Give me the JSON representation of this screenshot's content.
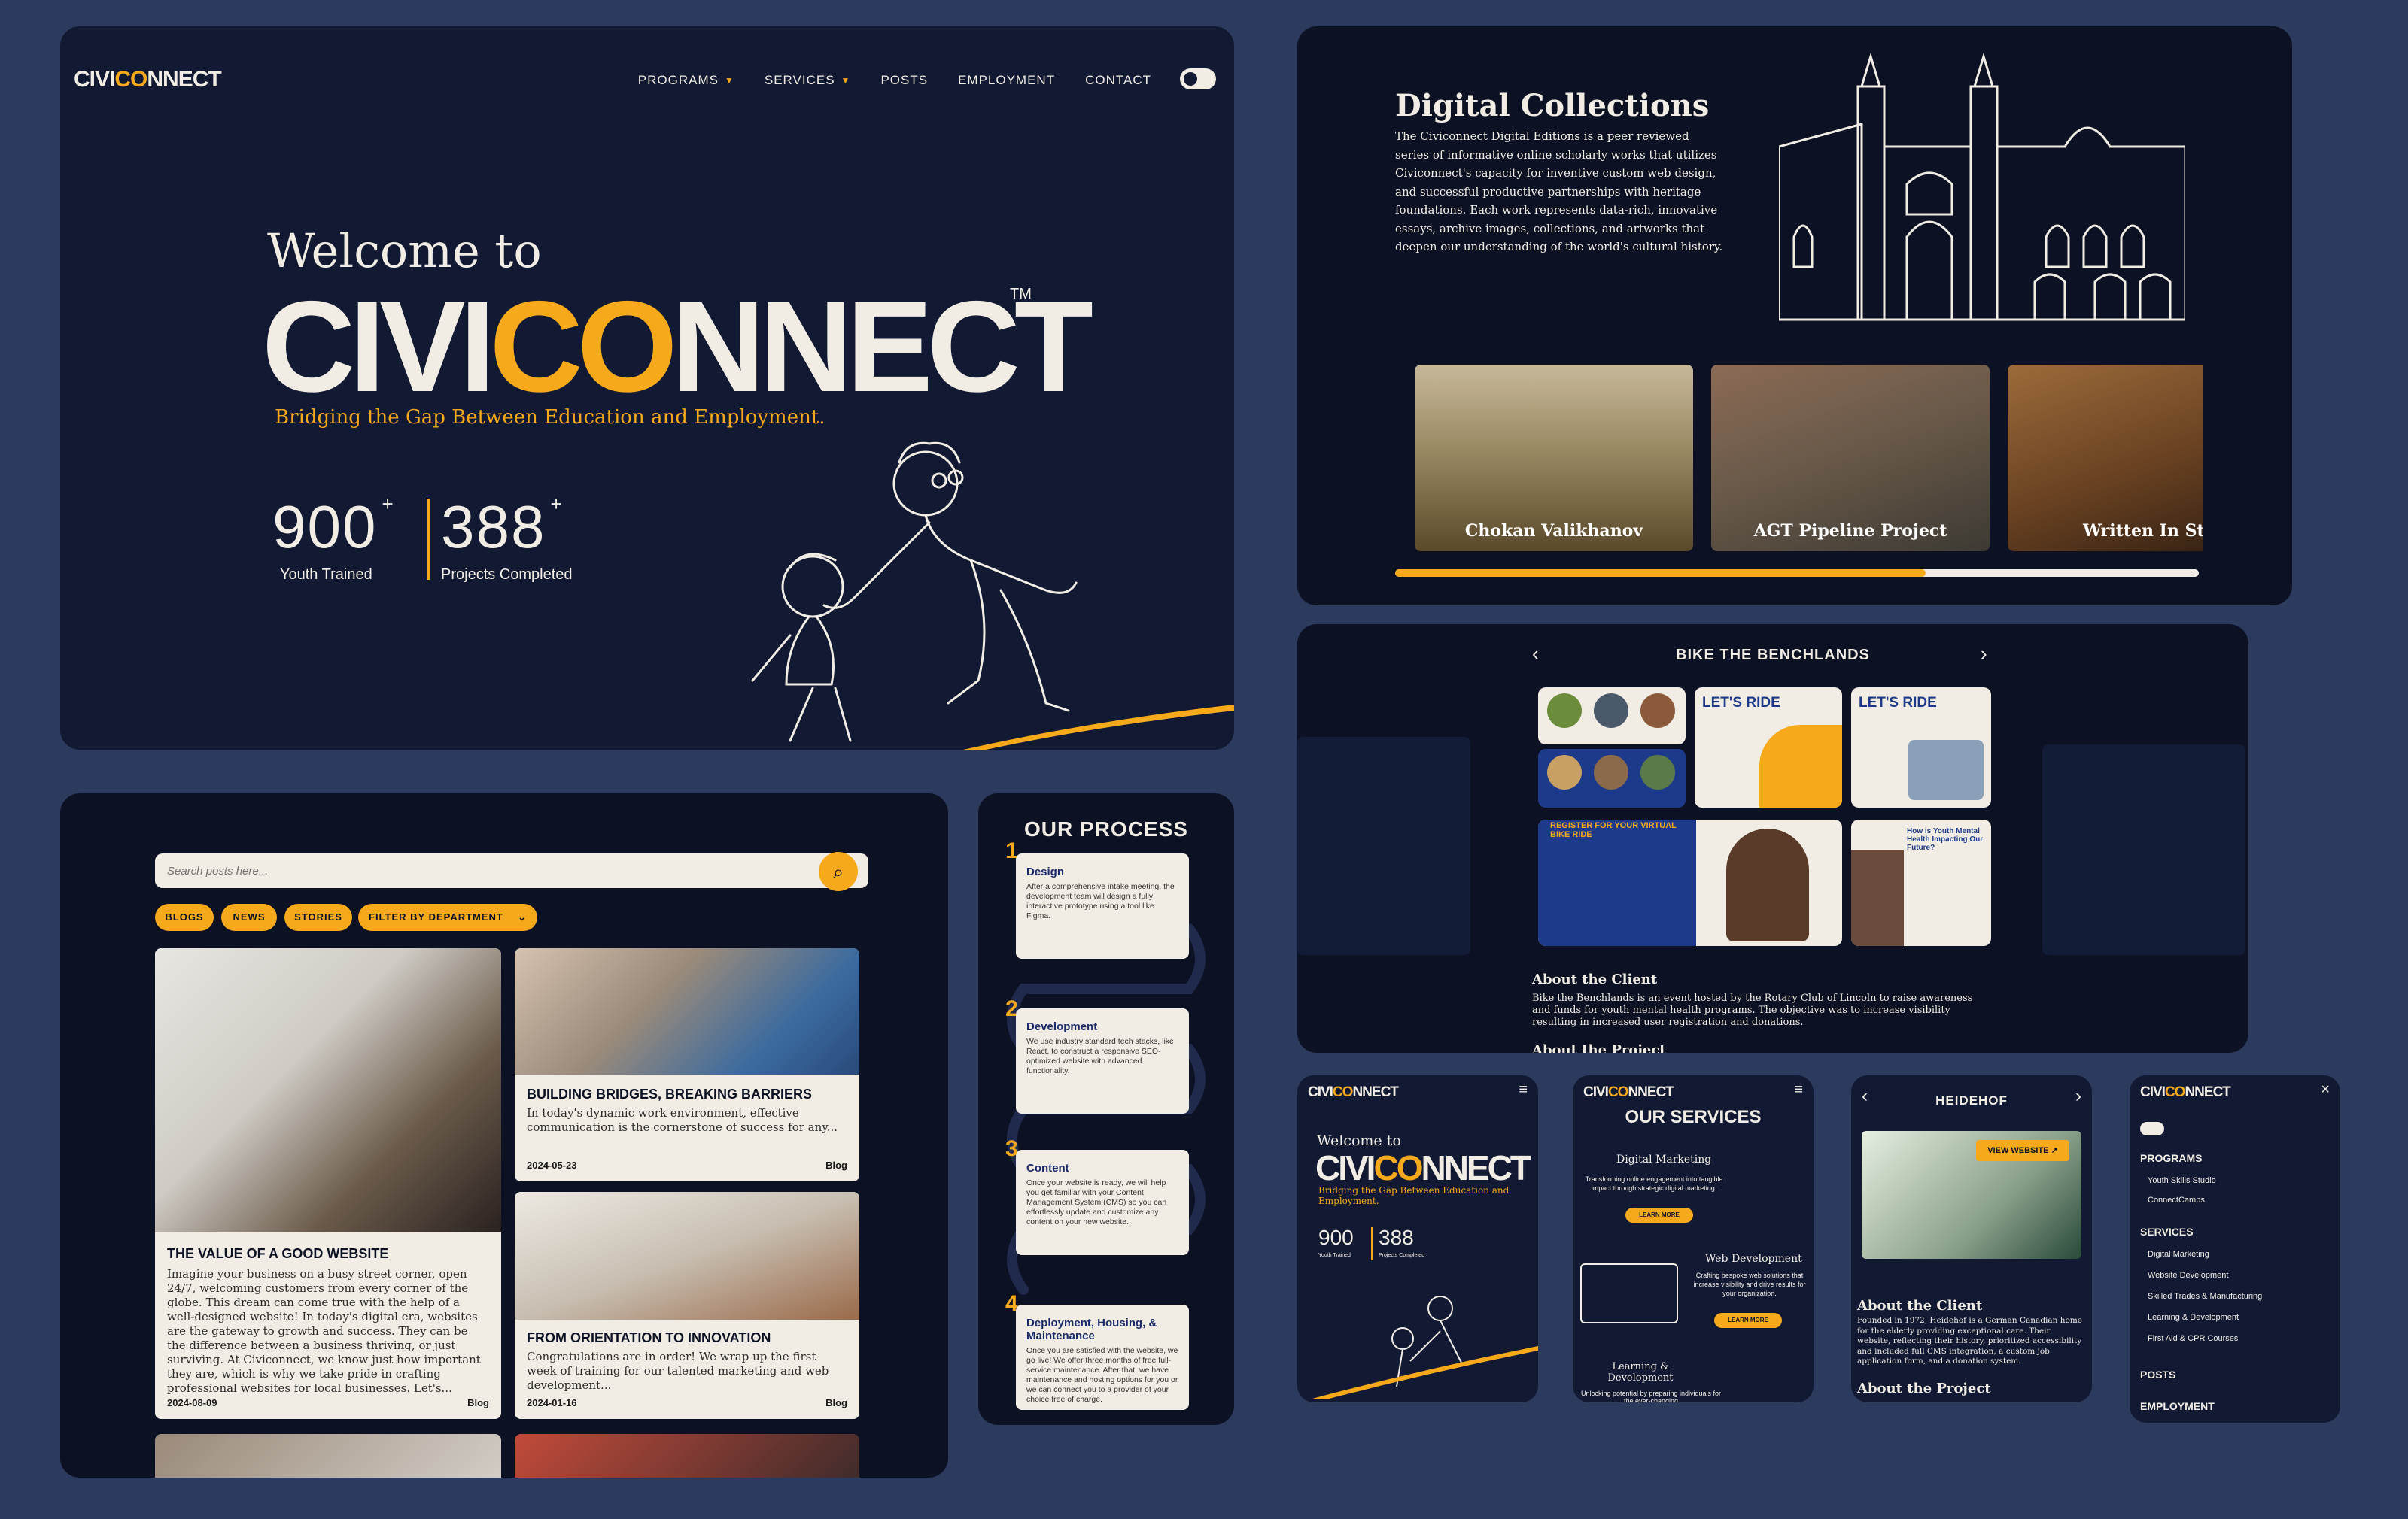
{
  "brand": {
    "part1": "CIVI",
    "part2": "CO",
    "part3": "NNECT",
    "tm": "TM"
  },
  "colors": {
    "accent": "#f6a91b",
    "navy": "#0f1428",
    "cream": "#f2ede4",
    "background": "#2c3a5e"
  },
  "hero": {
    "nav": [
      "PROGRAMS",
      "SERVICES",
      "POSTS",
      "EMPLOYMENT",
      "CONTACT"
    ],
    "welcome": "Welcome to",
    "title_a": "CIVI",
    "title_b": "CO",
    "title_c": "NNECT",
    "tagline": "Bridging the Gap Between Education and Employment.",
    "stats": [
      {
        "value": "900",
        "plus": "+",
        "label": "Youth Trained"
      },
      {
        "value": "388",
        "plus": "+",
        "label": "Projects Completed"
      }
    ]
  },
  "collections": {
    "title": "Digital Collections",
    "text": "The Civiconnect Digital Editions is a peer reviewed series of informative online scholarly works that utilizes Civiconnect's capacity for inventive custom web design, and successful productive partnerships with heritage foundations. Each work represents data-rich, innovative essays, archive images, collections, and artworks that deepen our understanding of the world's cultural history.",
    "cards": [
      "Chokan Valikhanov",
      "AGT Pipeline Project",
      "Written In Stone"
    ],
    "progress": 0.66
  },
  "bike": {
    "title": "BIKE THE BENCHLANDS",
    "prev": "‹",
    "next": "›",
    "lets_ride": "LET'S RIDE",
    "register": "REGISTER FOR YOUR VIRTUAL BIKE RIDE",
    "mental": "How is Youth Mental Health Impacting Our Future?",
    "about_client_title": "About the Client",
    "about_client_text": "Bike the Benchlands is an event hosted by the Rotary Club of Lincoln to raise awareness and funds for youth mental health programs. The objective was to increase visibility resulting in increased user registration and donations.",
    "about_project_title": "About the Project"
  },
  "blog": {
    "search_placeholder": "Search posts here...",
    "filters": [
      "BLOGS",
      "NEWS",
      "STORIES"
    ],
    "dept": "FILTER BY DEPARTMENT",
    "posts": [
      {
        "title": "THE VALUE OF A GOOD WEBSITE",
        "excerpt": "Imagine your business on a busy street corner, open 24/7, welcoming customers from every corner of the globe. This dream can come true with the help of a well-designed website! In today's digital era, websites are the gateway to growth and success. They can be the difference between a business thriving, or just surviving. At Civiconnect, we know just how important they are, which is why we take pride in crafting professional websites for local businesses. Let's...",
        "date": "2024-08-09",
        "category": "Blog"
      },
      {
        "title": "BUILDING BRIDGES, BREAKING BARRIERS",
        "excerpt": "In today's dynamic work environment, effective communication is the cornerstone of success for any...",
        "date": "2024-05-23",
        "category": "Blog"
      },
      {
        "title": "FROM ORIENTATION TO INNOVATION",
        "excerpt": "Congratulations are in order! We wrap up the first week of training for our talented marketing and web development...",
        "date": "2024-01-16",
        "category": "Blog"
      }
    ]
  },
  "process": {
    "title": "OUR PROCESS",
    "steps": [
      {
        "num": "1",
        "title": "Design",
        "text": "After a comprehensive intake meeting, the development team will design a fully interactive prototype using a tool like Figma."
      },
      {
        "num": "2",
        "title": "Development",
        "text": "We use industry standard tech stacks, like React, to construct a responsive SEO-optimized website with advanced functionality."
      },
      {
        "num": "3",
        "title": "Content",
        "text": "Once your website is ready, we will help you get familiar with your Content Management System (CMS) so you can effortlessly update and customize any content on your new website."
      },
      {
        "num": "4",
        "title": "Deployment, Housing, & Maintenance",
        "text": "Once you are satisfied with the website, we go live! We offer three months of free full-service maintenance. After that, we have maintenance and hosting options for you or we can connect you to a provider of your choice free of charge."
      }
    ]
  },
  "mobile": {
    "m1": {
      "welcome": "Welcome to",
      "tagline": "Bridging the Gap Between Education and Employment.",
      "stat1": "900",
      "stat1_label": "Youth Trained",
      "stat2": "388",
      "stat2_label": "Projects Completed"
    },
    "m2": {
      "title": "OUR SERVICES",
      "s1": "Digital Marketing",
      "s1_text": "Transforming online engagement into tangible impact through strategic digital marketing.",
      "learn": "LEARN MORE",
      "s2": "Web Development",
      "s2_text": "Crafting bespoke web solutions that increase visibility and drive results for your organization.",
      "s3": "Learning & Development",
      "s3_text": "Unlocking potential by preparing individuals for the ever-changing"
    },
    "m3": {
      "title": "HEIDEHOF",
      "view": "VIEW WEBSITE",
      "client_title": "About the Client",
      "client_text": "Founded in 1972, Heidehof is a German Canadian home for the elderly providing exceptional care. Their website, reflecting their history, prioritized accessibility and included full CMS integration, a custom job application form, and a donation system.",
      "project_title": "About the Project"
    },
    "m4": {
      "programs": "PROGRAMS",
      "p1": "Youth Skills Studio",
      "p2": "ConnectCamps",
      "services": "SERVICES",
      "sv1": "Digital Marketing",
      "sv2": "Website Development",
      "sv3": "Skilled Trades & Manufacturing",
      "sv4": "Learning & Development",
      "sv5": "First Aid & CPR Courses",
      "posts": "POSTS",
      "employment": "EMPLOYMENT"
    }
  }
}
